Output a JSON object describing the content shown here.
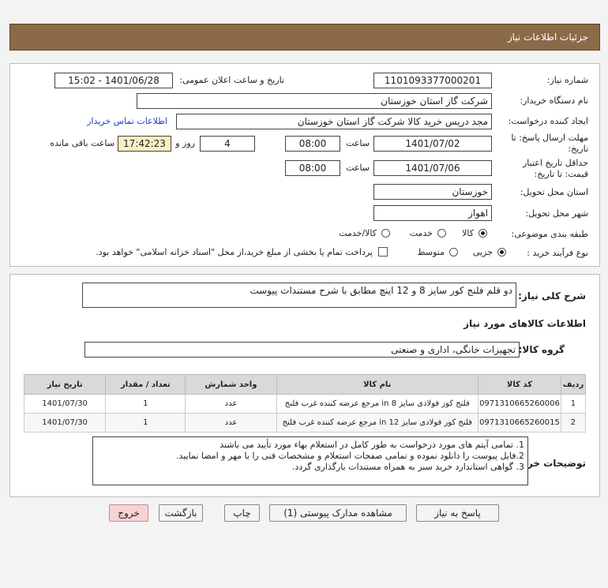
{
  "header_title": "جزئیات اطلاعات نیاز",
  "fields": {
    "need_number_label": "شماره نیاز:",
    "need_number": "1101093377000201",
    "announce_label": "تاریخ و ساعت اعلان عمومی:",
    "announce_value": "1401/06/28 - 15:02",
    "buyer_org_label": "نام دستگاه خریدار:",
    "buyer_org": "شرکت گاز استان خوزستان",
    "creator_label": "ایجاد کننده درخواست:",
    "creator": "مجد دریس خرید کالا شرکت گاز استان خوزستان",
    "contact_link": "اطلاعات تماس خریدار",
    "deadline_label": "مهلت ارسال پاسخ: تا تاریخ:",
    "deadline_date": "1401/07/02",
    "time_label": "ساعت",
    "deadline_time": "08:00",
    "days_value": "4",
    "days_label": "روز و",
    "remaining_time": "17:42:23",
    "remaining_label": "ساعت باقی مانده",
    "validity_label": "حداقل تاریخ اعتبار قیمت: تا تاریخ:",
    "validity_date": "1401/07/06",
    "validity_time": "08:00",
    "province_label": "استان محل تحویل:",
    "province": "خوزستان",
    "city_label": "شهر محل تحویل:",
    "city": "اهواز",
    "category_label": "طبقه بندی موضوعی:",
    "category_options": [
      "کالا",
      "خدمت",
      "کالا/خدمت"
    ],
    "process_label": "نوع فرآیند خرید :",
    "process_options": [
      "جزیی",
      "متوسط"
    ],
    "treasury_note": "پرداخت تمام یا بخشی از مبلغ خرید،از محل \"اسناد خزانه اسلامی\" خواهد بود."
  },
  "description": {
    "label": "شرح کلی نیاز:",
    "text": "دو قلم فلنج کور سایز 8 و 12 اینچ مطابق با شرح مستندات پیوست"
  },
  "goods_info_title": "اطلاعات کالاهای مورد نیاز",
  "goods_group": {
    "label": "گروه کالا:",
    "value": "تجهیزات خانگی، اداری و صنعتی"
  },
  "table": {
    "headers": [
      "ردیف",
      "کد کالا",
      "نام کالا",
      "واحد شمارش",
      "تعداد / مقدار",
      "تاریخ نیاز"
    ],
    "rows": [
      [
        "1",
        "0971310665260006",
        "فلنج کور فولادی سایز 8 in مرجع عرضه کننده غرب فلنج",
        "عدد",
        "1",
        "1401/07/30"
      ],
      [
        "2",
        "0971310665260015",
        "فلنج کور فولادی سایز 12 in مرجع عرضه کننده غرب فلنج",
        "عدد",
        "1",
        "1401/07/30"
      ]
    ]
  },
  "buyer_notes": {
    "label": "توضیحات خریدار:",
    "lines": [
      "1. تمامی آیتم های مورد درخواست به طور کامل در استعلام بهاء مورد تأیید می باشند",
      "2.فایل پیوست را دانلود نموده و تمامی صفحات استعلام و مشخصات فنی را با مهر و امضا نمایید.",
      "3. گواهی استاندارد خرید سبز به همراه مستندات بارگذاری گردد."
    ]
  },
  "buttons": {
    "reply": "پاسخ به نیاز",
    "attachments": "مشاهده مدارک پیوستی (1)",
    "print": "چاپ",
    "back": "بازگشت",
    "exit": "خروج"
  },
  "colors": {
    "header_bg": "#8b6a48",
    "remaining_bg": "#f7f0c2",
    "exit_bg": "#f7d3d3",
    "link": "#1f3fbf"
  }
}
